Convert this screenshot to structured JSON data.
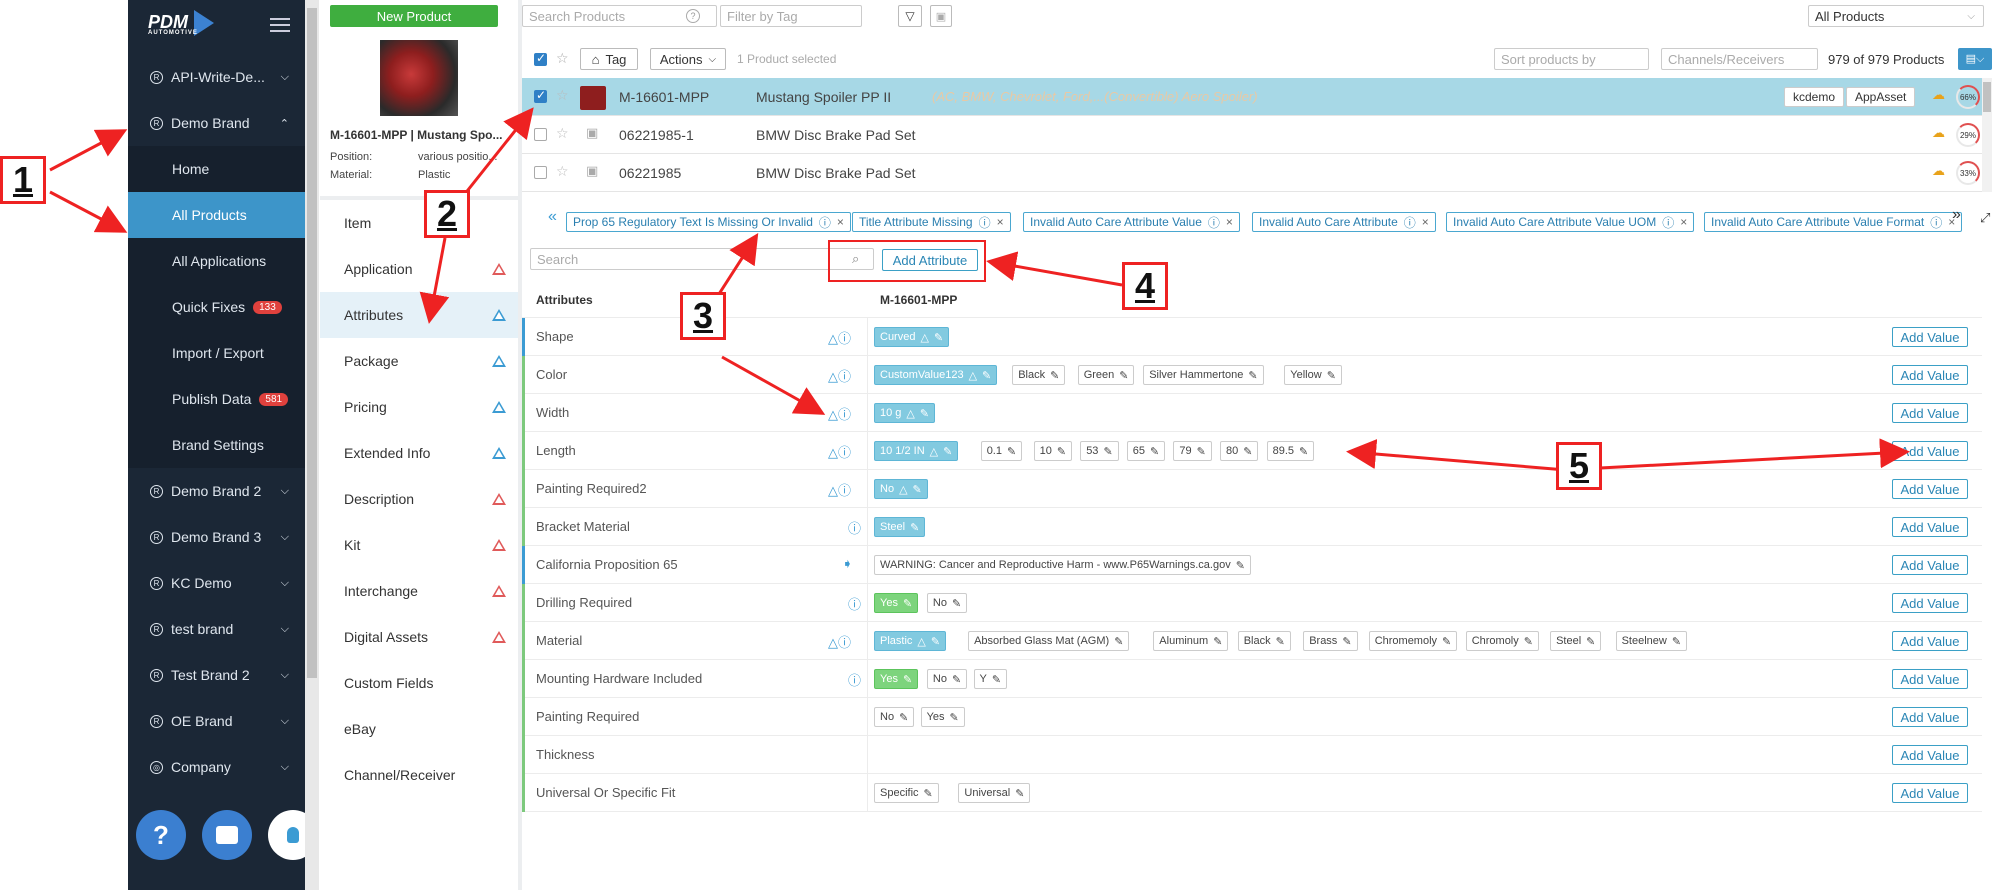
{
  "sidebar": {
    "logo": "PDM",
    "logo_sub": "AUTOMOTIVE",
    "items": [
      {
        "label": "API-Write-De...",
        "type": "brand"
      },
      {
        "label": "Demo Brand",
        "type": "brand-open"
      },
      {
        "label": "Home",
        "type": "sub"
      },
      {
        "label": "All Products",
        "type": "sub-active"
      },
      {
        "label": "All Applications",
        "type": "sub"
      },
      {
        "label": "Quick Fixes",
        "type": "sub",
        "badge": "133"
      },
      {
        "label": "Import / Export",
        "type": "sub"
      },
      {
        "label": "Publish Data",
        "type": "sub",
        "badge": "581"
      },
      {
        "label": "Brand Settings",
        "type": "sub"
      },
      {
        "label": "Demo Brand 2",
        "type": "brand"
      },
      {
        "label": "Demo Brand 3",
        "type": "brand"
      },
      {
        "label": "KC Demo",
        "type": "brand"
      },
      {
        "label": "test brand",
        "type": "brand"
      },
      {
        "label": "Test Brand 2",
        "type": "brand"
      },
      {
        "label": "OE Brand",
        "type": "brand"
      },
      {
        "label": "Company",
        "type": "company"
      }
    ],
    "bottom_icons": [
      "help-icon",
      "chat-icon",
      "lightbulb-icon"
    ]
  },
  "toolbar": {
    "new_product": "New Product",
    "search_placeholder": "Search Products",
    "filter_placeholder": "Filter by Tag",
    "all_products": "All Products",
    "tag_label": "Tag",
    "actions_label": "Actions",
    "selected_text": "1 Product selected",
    "sort_placeholder": "Sort products by",
    "channels_placeholder": "Channels/Receivers",
    "count_text": "979 of 979 Products"
  },
  "product": {
    "title": "M-16601-MPP | Mustang Spo...",
    "position_label": "Position:",
    "position_value": "various positio...",
    "material_label": "Material:",
    "material_value": "Plastic"
  },
  "products": [
    {
      "sku": "M-16601-MPP",
      "name": "Mustang Spoiler PP II",
      "extra": "(AC, BMW, Chevrolet, Ford,...(Convertible) Aero Spoiler)",
      "tags": [
        "kcdemo",
        "AppAsset"
      ],
      "pct": "66%",
      "selected": true
    },
    {
      "sku": "06221985-1",
      "name": "BMW Disc Brake Pad Set",
      "extra": "",
      "tags": [],
      "pct": "29%",
      "selected": false
    },
    {
      "sku": "06221985",
      "name": "BMW Disc Brake Pad Set",
      "extra": "",
      "tags": [],
      "pct": "33%",
      "selected": false
    }
  ],
  "tabs": [
    {
      "label": "Item",
      "warn": ""
    },
    {
      "label": "Application",
      "warn": "red"
    },
    {
      "label": "Attributes",
      "warn": "blue"
    },
    {
      "label": "Package",
      "warn": "blue"
    },
    {
      "label": "Pricing",
      "warn": "blue"
    },
    {
      "label": "Extended Info",
      "warn": "blue"
    },
    {
      "label": "Description",
      "warn": "red"
    },
    {
      "label": "Kit",
      "warn": "red"
    },
    {
      "label": "Interchange",
      "warn": "red"
    },
    {
      "label": "Digital Assets",
      "warn": "red"
    },
    {
      "label": "Custom Fields",
      "warn": ""
    },
    {
      "label": "eBay",
      "warn": ""
    },
    {
      "label": "Channel/Receiver",
      "warn": ""
    }
  ],
  "issues": [
    "Prop 65 Regulatory Text Is Missing Or Invalid",
    "Title Attribute Missing",
    "Invalid Auto Care Attribute Value",
    "Invalid Auto Care Attribute",
    "Invalid Auto Care Attribute Value UOM",
    "Invalid Auto Care Attribute Value Format"
  ],
  "attr_search_placeholder": "Search",
  "add_attribute": "Add Attribute",
  "attr_header": {
    "col1": "Attributes",
    "col2": "M-16601-MPP"
  },
  "add_value": "Add Value",
  "attributes": [
    {
      "name": "Shape",
      "bar": "#3b9bd3",
      "icons": "△ⓘ",
      "values": [
        {
          "t": "Curved",
          "s": "hl",
          "warn": true
        }
      ]
    },
    {
      "name": "Color",
      "bar": "#7dc97d",
      "icons": "△ⓘ",
      "values": [
        {
          "t": "CustomValue123",
          "s": "hl",
          "warn": true
        },
        {
          "t": "Black"
        },
        {
          "t": "Green"
        },
        {
          "t": "Silver Hammertone"
        },
        {
          "t": "Yellow"
        }
      ]
    },
    {
      "name": "Width",
      "bar": "#7dc97d",
      "icons": "△ⓘ",
      "values": [
        {
          "t": "10 g",
          "s": "hl",
          "warn": true
        }
      ]
    },
    {
      "name": "Length",
      "bar": "#7dc97d",
      "icons": "△ⓘ",
      "values": [
        {
          "t": "10 1/2 IN",
          "s": "hl",
          "warn": true
        },
        {
          "t": "0.1"
        },
        {
          "t": "10"
        },
        {
          "t": "53"
        },
        {
          "t": "65"
        },
        {
          "t": "79"
        },
        {
          "t": "80"
        },
        {
          "t": "89.5"
        }
      ]
    },
    {
      "name": "Painting Required2",
      "bar": "#7dc97d",
      "icons": "△ⓘ",
      "values": [
        {
          "t": "No",
          "s": "hl",
          "warn": true
        }
      ]
    },
    {
      "name": "Bracket Material",
      "bar": "#7dc97d",
      "icons": "ⓘ",
      "values": [
        {
          "t": "Steel",
          "s": "hl"
        }
      ]
    },
    {
      "name": "California Proposition 65",
      "bar": "#3b9bd3",
      "icons": "tag",
      "values": [
        {
          "t": "WARNING: Cancer and Reproductive Harm - www.P65Warnings.ca.gov"
        }
      ]
    },
    {
      "name": "Drilling Required",
      "bar": "#7dc97d",
      "icons": "ⓘ",
      "values": [
        {
          "t": "Yes",
          "s": "gr"
        },
        {
          "t": "No"
        }
      ]
    },
    {
      "name": "Material",
      "bar": "#7dc97d",
      "icons": "△ⓘ",
      "values": [
        {
          "t": "Plastic",
          "s": "hl",
          "warn": true
        },
        {
          "t": "Absorbed Glass Mat (AGM)"
        },
        {
          "t": "Aluminum"
        },
        {
          "t": "Black"
        },
        {
          "t": "Brass"
        },
        {
          "t": "Chromemoly"
        },
        {
          "t": "Chromoly"
        },
        {
          "t": "Steel"
        },
        {
          "t": "Steelnew"
        }
      ]
    },
    {
      "name": "Mounting Hardware Included",
      "bar": "#7dc97d",
      "icons": "ⓘ",
      "values": [
        {
          "t": "Yes",
          "s": "gr"
        },
        {
          "t": "No"
        },
        {
          "t": "Y"
        }
      ]
    },
    {
      "name": "Painting Required",
      "bar": "#7dc97d",
      "icons": "",
      "values": [
        {
          "t": "No"
        },
        {
          "t": "Yes"
        }
      ]
    },
    {
      "name": "Thickness",
      "bar": "#7dc97d",
      "icons": "",
      "values": []
    },
    {
      "name": "Universal Or Specific Fit",
      "bar": "#7dc97d",
      "icons": "",
      "values": [
        {
          "t": "Specific"
        },
        {
          "t": "Universal"
        }
      ]
    }
  ],
  "annotations": [
    "1",
    "2",
    "3",
    "4",
    "5"
  ],
  "colors": {
    "accent": "#3d95c9",
    "sidebar": "#1b2736",
    "success": "#3fae3f",
    "annotation": "#e22222"
  }
}
